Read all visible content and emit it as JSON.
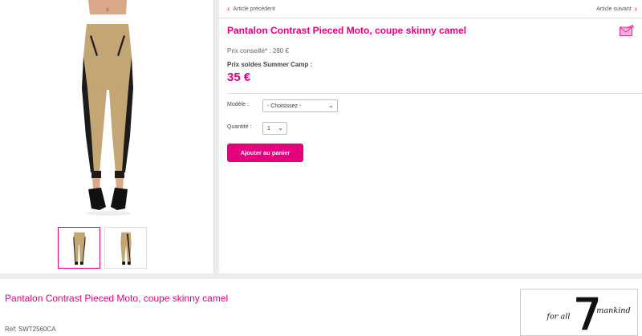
{
  "navigation": {
    "prev_label": "Article précédent",
    "next_label": "Article suivant"
  },
  "product": {
    "title": "Pantalon Contrast Pieced Moto, coupe skinny camel",
    "retail_price_label": "Prix conseillé* : 280 €",
    "sale_label": "Prix soldes Summer Camp :",
    "sale_price": "35 €",
    "model_label": "Modèle :",
    "model_selected": "- Choisissez -",
    "quantity_label": "Quantité :",
    "quantity_selected": "1",
    "add_to_cart_label": "Ajouter au panier",
    "reference": "Réf: SWT2560CA"
  },
  "brand": {
    "logo_text": "for all mankind",
    "logo_numeral": "7"
  },
  "colors": {
    "accent": "#e5007e",
    "camel": "#c4a574",
    "trim": "#1b1b1b"
  },
  "icons": {
    "prev": "chevron-left-icon",
    "next": "chevron-right-icon",
    "share": "share-mail-icon",
    "dropdown": "chevron-down-icon"
  }
}
